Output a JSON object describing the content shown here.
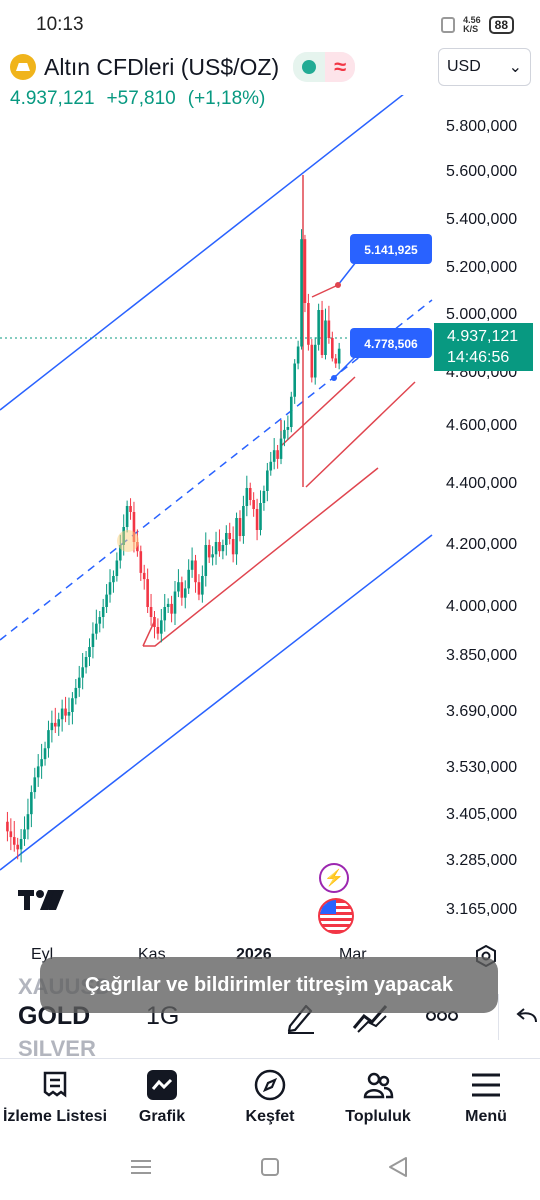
{
  "status_bar": {
    "time": "10:13",
    "net_speed_top": "4.56",
    "net_speed_bottom": "K/S",
    "battery": "88"
  },
  "header": {
    "symbol_title": "Altın CFDleri (US$/OZ)",
    "last_price": "4.937,121",
    "change": "+57,810",
    "change_percent": "(+1,18%)",
    "currency": "USD",
    "currency_caret": "⌄"
  },
  "colors": {
    "up": "#089981",
    "down": "#f23645",
    "channel": "#2962ff",
    "trendline": "#e0454f",
    "accent": "#2962ff"
  },
  "chart": {
    "price_axis": [
      "5.800,000",
      "5.600,000",
      "5.400,000",
      "5.200,000",
      "5.000,000",
      "4.800,000",
      "4.600,000",
      "4.400,000",
      "4.200,000",
      "4.000,000",
      "3.850,000",
      "3.690,000",
      "3.530,000",
      "3.405,000",
      "3.285,000",
      "3.165,000"
    ],
    "current_price_tag": {
      "price": "4.937,121",
      "countdown": "14:46:56"
    },
    "callouts": [
      {
        "value": "5.141,925"
      },
      {
        "value": "4.778,506"
      }
    ],
    "time_axis": [
      {
        "label": "Eyl",
        "bold": false
      },
      {
        "label": "Kas",
        "bold": false
      },
      {
        "label": "2026",
        "bold": true
      },
      {
        "label": "Mar",
        "bold": false
      }
    ]
  },
  "chart_data": {
    "type": "candlestick",
    "symbol": "GOLD",
    "interval": "1G",
    "ylim": [
      3150,
      5850
    ],
    "x_ticks": [
      "Eyl",
      "Kas",
      "2026",
      "Mar"
    ],
    "close_series": [
      3390,
      3365,
      3350,
      3330,
      3318,
      3345,
      3370,
      3410,
      3470,
      3510,
      3540,
      3560,
      3590,
      3640,
      3660,
      3650,
      3670,
      3700,
      3680,
      3690,
      3730,
      3760,
      3790,
      3820,
      3850,
      3880,
      3920,
      3950,
      3970,
      4000,
      4040,
      4080,
      4100,
      4150,
      4200,
      4260,
      4330,
      4310,
      4210,
      4180,
      4110,
      4090,
      4000,
      3970,
      3940,
      3920,
      3960,
      4000,
      4010,
      3980,
      4050,
      4080,
      4030,
      4060,
      4120,
      4150,
      4080,
      4040,
      4100,
      4200,
      4160,
      4170,
      4210,
      4180,
      4200,
      4240,
      4220,
      4170,
      4290,
      4230,
      4330,
      4390,
      4350,
      4320,
      4250,
      4340,
      4380,
      4450,
      4480,
      4520,
      4490,
      4560,
      4590,
      4600,
      4710,
      4850,
      4950,
      5320,
      5100,
      4960,
      4780,
      4960,
      5080,
      4900,
      5050,
      5000,
      4880,
      4850,
      4937
    ],
    "last_price": 4937.121,
    "change": 57.81,
    "change_percent": 1.18,
    "annotations": [
      5141.925,
      4778.506
    ]
  },
  "bottom_strip": {
    "ticker_above": "XAUUSD",
    "ticker": "GOLD",
    "interval": "1G",
    "ticker_below": "SILVER"
  },
  "toast": "Çağrılar ve bildirimler titreşim yapacak",
  "nav": [
    {
      "label": "İzleme Listesi",
      "icon": "watchlist-icon"
    },
    {
      "label": "Grafik",
      "icon": "chart-icon"
    },
    {
      "label": "Keşfet",
      "icon": "compass-icon"
    },
    {
      "label": "Topluluk",
      "icon": "community-icon"
    },
    {
      "label": "Menü",
      "icon": "menu-icon"
    }
  ]
}
